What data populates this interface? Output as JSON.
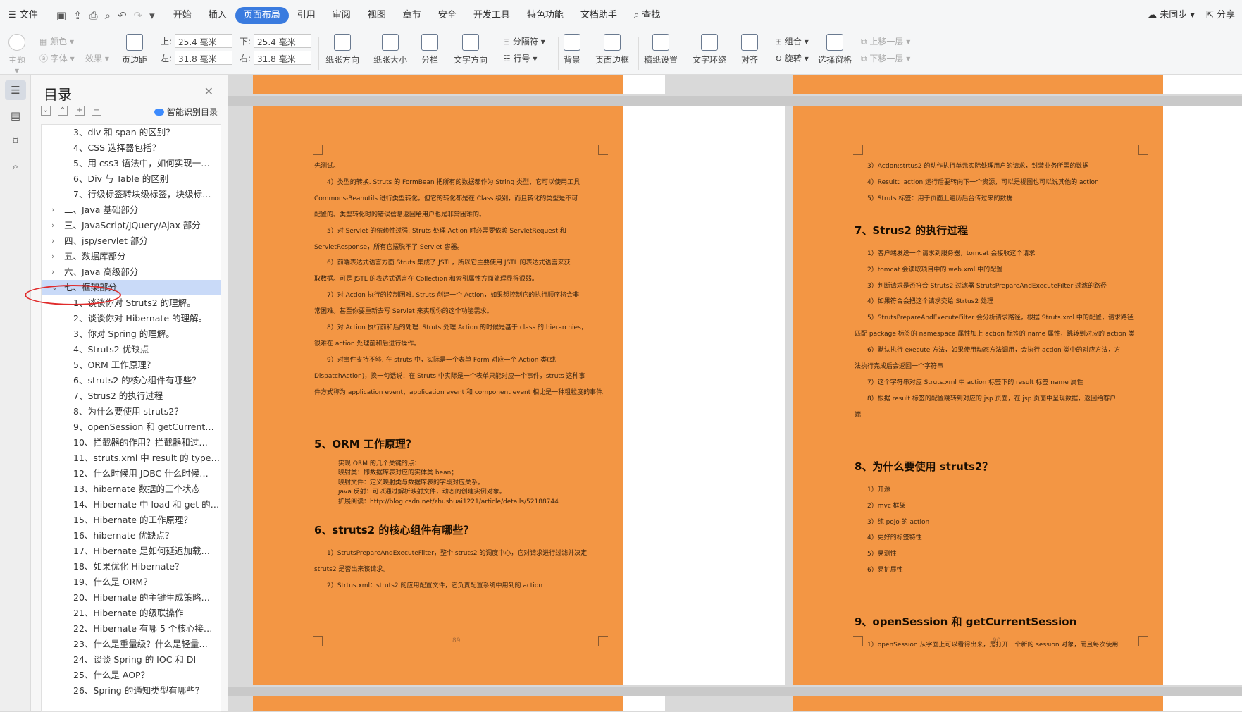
{
  "menubar": {
    "file": "文件",
    "tabs": [
      "开始",
      "插入",
      "页面布局",
      "引用",
      "审阅",
      "视图",
      "章节",
      "安全",
      "开发工具",
      "特色功能",
      "文档助手"
    ],
    "active_tab": "页面布局",
    "search": "查找",
    "sync": "未同步",
    "share": "分享"
  },
  "ribbon": {
    "theme": "主题",
    "color": "颜色",
    "font": "字体",
    "effect": "效果",
    "margin": "页边距",
    "top_label": "上:",
    "top_val": "25.4 毫米",
    "bottom_label": "下:",
    "bottom_val": "25.4 毫米",
    "left_label": "左:",
    "left_val": "31.8 毫米",
    "right_label": "右:",
    "right_val": "31.8 毫米",
    "orientation": "纸张方向",
    "size": "纸张大小",
    "columns": "分栏",
    "text_direction": "文字方向",
    "separator": "分隔符",
    "line_num": "行号",
    "background": "背景",
    "page_border": "页面边框",
    "paper_setting": "稿纸设置",
    "text_wrap": "文字环绕",
    "align": "对齐",
    "group": "组合",
    "rotate": "旋转",
    "select_pane": "选择窗格",
    "bring_forward": "上移一层",
    "send_backward": "下移一层"
  },
  "toc": {
    "title": "目录",
    "smart": "智能识别目录",
    "items": [
      {
        "t": "3、div 和 span 的区别？",
        "l": 2
      },
      {
        "t": "4、CSS 选择器包括？",
        "l": 2
      },
      {
        "t": "5、用 css3 语法中，如何实现一…",
        "l": 2
      },
      {
        "t": "6、Div 与 Table 的区别",
        "l": 2
      },
      {
        "t": "7、行级标签转块级标签，块级标…",
        "l": 2
      },
      {
        "t": "二、Java 基础部分",
        "l": 1,
        "c": ">"
      },
      {
        "t": "三、JavaScript/JQuery/Ajax 部分",
        "l": 1,
        "c": ">"
      },
      {
        "t": "四、jsp/servlet 部分",
        "l": 1,
        "c": ">"
      },
      {
        "t": "五、数据库部分",
        "l": 1,
        "c": ">"
      },
      {
        "t": "六、Java 高级部分",
        "l": 1,
        "c": ">"
      },
      {
        "t": "七、框架部分",
        "l": 1,
        "c": "v",
        "sel": true
      },
      {
        "t": "1、谈谈你对 Struts2 的理解。",
        "l": 2
      },
      {
        "t": "2、谈谈你对 Hibernate 的理解。",
        "l": 2
      },
      {
        "t": "3、你对 Spring 的理解。",
        "l": 2
      },
      {
        "t": "4、Struts2 优缺点",
        "l": 2
      },
      {
        "t": "5、ORM 工作原理？",
        "l": 2
      },
      {
        "t": "6、struts2 的核心组件有哪些？",
        "l": 2
      },
      {
        "t": "7、Strus2 的执行过程",
        "l": 2
      },
      {
        "t": "8、为什么要使用 struts2？",
        "l": 2
      },
      {
        "t": "9、openSession 和 getCurrent…",
        "l": 2
      },
      {
        "t": "10、拦截器的作用？拦截器和过…",
        "l": 2
      },
      {
        "t": "11、struts.xml 中 result 的 type …",
        "l": 2
      },
      {
        "t": "12、什么时候用 JDBC 什么时候…",
        "l": 2
      },
      {
        "t": "13、hibernate 数据的三个状态",
        "l": 2
      },
      {
        "t": "14、Hibernate 中 load 和 get 的…",
        "l": 2
      },
      {
        "t": "15、Hibernate 的工作原理？",
        "l": 2
      },
      {
        "t": "16、hibernate 优缺点？",
        "l": 2
      },
      {
        "t": "17、Hibernate 是如何延迟加载…",
        "l": 2
      },
      {
        "t": "18、如果优化 Hibernate？",
        "l": 2
      },
      {
        "t": "19、什么是 ORM？",
        "l": 2
      },
      {
        "t": "20、Hibernate 的主键生成策略…",
        "l": 2
      },
      {
        "t": "21、Hibernate 的级联操作",
        "l": 2
      },
      {
        "t": "22、Hibernate 有哪 5 个核心接…",
        "l": 2
      },
      {
        "t": "23、什么是重量级？什么是轻量…",
        "l": 2
      },
      {
        "t": "24、谈谈 Spring 的 IOC 和 DI",
        "l": 2
      },
      {
        "t": "25、什么是 AOP？",
        "l": 2
      },
      {
        "t": "26、Spring 的通知类型有哪些？",
        "l": 2
      }
    ]
  },
  "page1": {
    "page_number": "89",
    "blocks": [
      {
        "k": "p",
        "t": "先测试。"
      },
      {
        "k": "p",
        "i": 1,
        "t": "4）类型的转换. Struts 的 FormBean 把所有的数据都作为 String 类型，它可以使用工具"
      },
      {
        "k": "p",
        "t": "Commons-Beanutils 进行类型转化。但它的转化都是在 Class 级别，而且转化的类型是不可"
      },
      {
        "k": "p",
        "t": "配置的。类型转化时的错误信息返回给用户也是非常困难的。"
      },
      {
        "k": "p",
        "i": 1,
        "t": "5）对 Servlet 的依赖性过强. Struts 处理 Action 时必需要依赖 ServletRequest 和"
      },
      {
        "k": "p",
        "t": "ServletResponse，所有它摆脱不了 Servlet 容器。"
      },
      {
        "k": "p",
        "i": 1,
        "t": "6）前端表达式语言方面.Struts 集成了 JSTL，所以它主要使用 JSTL 的表达式语言来获"
      },
      {
        "k": "p",
        "t": "取数据。可是 JSTL 的表达式语言在 Collection 和索引属性方面处理显得很弱。"
      },
      {
        "k": "p",
        "i": 1,
        "t": "7）对 Action 执行的控制困难. Struts 创建一个 Action，如果想控制它的执行顺序将会非"
      },
      {
        "k": "p",
        "t": "常困难。甚至你要重新去写 Servlet 来实现你的这个功能需求。"
      },
      {
        "k": "p",
        "i": 1,
        "t": "8）对 Action 执行前和后的处理. Struts 处理 Action 的时候是基于 class 的 hierarchies，"
      },
      {
        "k": "p",
        "t": "很难在 action 处理前和后进行操作。"
      },
      {
        "k": "p",
        "i": 1,
        "t": "9）对事件支持不够. 在 struts 中，实际是一个表单 Form 对应一个 Action 类(或"
      },
      {
        "k": "p",
        "t": "DispatchAction)，换一句话说：在 Struts 中实际是一个表单只能对应一个事件，struts 这种事"
      },
      {
        "k": "p",
        "t": "件方式称为 application event，application event 和 component event 相比是一种粗粒度的事件。"
      },
      {
        "k": "gap"
      },
      {
        "k": "h",
        "t": "5、ORM 工作原理？"
      },
      {
        "k": "p",
        "i": 2,
        "t": "实现 ORM 的几个关键的点："
      },
      {
        "k": "p",
        "i": 2,
        "t": "映射类：即数据库表对应的实体类 bean；"
      },
      {
        "k": "p",
        "i": 2,
        "t": "映射文件：定义映射类与数据库表的字段对应关系。"
      },
      {
        "k": "p",
        "i": 2,
        "t": "java 反射：可以通过解析映射文件，动态的创建实例对象。"
      },
      {
        "k": "p",
        "i": 2,
        "t": "扩展阅读：http://blog.csdn.net/zhushuai1221/article/details/52188744"
      },
      {
        "k": "h",
        "t": "6、struts2 的核心组件有哪些？"
      },
      {
        "k": "p",
        "i": 1,
        "t": "1）StrutsPrepareAndExecuteFilter，整个 struts2 的调度中心，它对请求进行过滤并决定"
      },
      {
        "k": "p",
        "t": "struts2 是否出来该请求。"
      },
      {
        "k": "p",
        "i": 1,
        "t": "2）Strtus.xml：struts2 的应用配置文件，它负责配置系统中用到的 action"
      }
    ]
  },
  "page2": {
    "page_number": "90",
    "blocks": [
      {
        "k": "p",
        "i": 1,
        "t": "3）Action:strtus2 的动作执行单元实际处理用户的请求，封装业务所需的数据"
      },
      {
        "k": "p",
        "i": 1,
        "t": "4）Result：action 运行后要转向下一个资源，可以是视图也可以说其他的 action"
      },
      {
        "k": "p",
        "i": 1,
        "t": "5）Struts 标签：用于页面上遍历后台传过来的数据"
      },
      {
        "k": "h",
        "t": "7、Strus2 的执行过程"
      },
      {
        "k": "p",
        "i": 1,
        "t": "1）客户端发送一个请求到服务器，tomcat 会接收这个请求"
      },
      {
        "k": "p",
        "i": 1,
        "t": "2）tomcat 会读取项目中的 web.xml 中的配置"
      },
      {
        "k": "p",
        "i": 1,
        "t": "3）判断请求是否符合 Struts2 过滤器 StrutsPrepareAndExecuteFilter 过滤的路径"
      },
      {
        "k": "p",
        "i": 1,
        "t": "4）如果符合会把这个请求交给 Strtus2 处理"
      },
      {
        "k": "p",
        "i": 1,
        "t": "5）StrutsPrepareAndExecuteFilter 会分析请求路径，根据 Struts.xml 中的配置，请求路径"
      },
      {
        "k": "p",
        "t": "匹配 package 标签的 namespace 属性加上 action 标签的 name 属性，跳转到对应的 action 类"
      },
      {
        "k": "p",
        "i": 1,
        "t": "6）默认执行 execute 方法，如果使用动态方法调用，会执行 action 类中的对应方法，方"
      },
      {
        "k": "p",
        "t": "法执行完成后会返回一个字符串"
      },
      {
        "k": "p",
        "i": 1,
        "t": "7）这个字符串对应 Struts.xml 中 action 标签下的 result 标签 name 属性"
      },
      {
        "k": "p",
        "i": 1,
        "t": "8）根据 result 标签的配置跳转到对应的 jsp 页面，在 jsp 页面中呈现数据，返回给客户"
      },
      {
        "k": "p",
        "t": "端"
      },
      {
        "k": "gap"
      },
      {
        "k": "h",
        "t": "8、为什么要使用 struts2？"
      },
      {
        "k": "p",
        "i": 1,
        "t": "1）开源"
      },
      {
        "k": "p",
        "i": 1,
        "t": "2）mvc 框架"
      },
      {
        "k": "p",
        "i": 1,
        "t": "3）纯 pojo 的 action"
      },
      {
        "k": "p",
        "i": 1,
        "t": "4）更好的标签特性"
      },
      {
        "k": "p",
        "i": 1,
        "t": "5）易测性"
      },
      {
        "k": "p",
        "i": 1,
        "t": "6）易扩展性"
      },
      {
        "k": "gap"
      },
      {
        "k": "h",
        "t": "9、openSession 和 getCurrentSession"
      },
      {
        "k": "p",
        "i": 1,
        "t": "1）openSession 从字面上可以看得出来，是打开一个新的 session 对象，而且每次使用"
      }
    ]
  }
}
